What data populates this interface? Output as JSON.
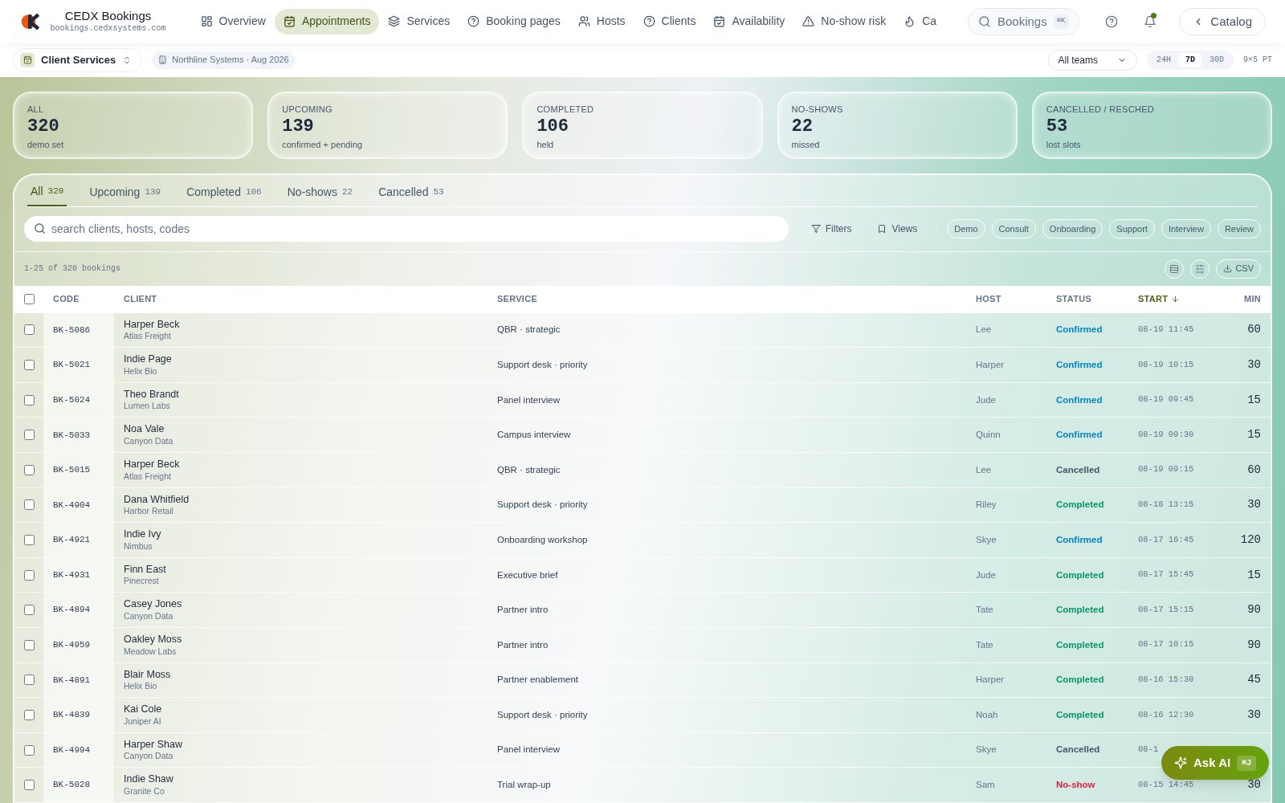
{
  "brand": {
    "name": "CEDX Bookings",
    "domain": "bookings.cedxsystems.com"
  },
  "nav": [
    {
      "label": "Overview",
      "selected": false
    },
    {
      "label": "Appointments",
      "selected": true
    },
    {
      "label": "Services",
      "selected": false
    },
    {
      "label": "Booking pages",
      "selected": false
    },
    {
      "label": "Hosts",
      "selected": false
    },
    {
      "label": "Clients",
      "selected": false
    },
    {
      "label": "Availability",
      "selected": false
    },
    {
      "label": "No-show risk",
      "selected": false
    },
    {
      "label": "Ca",
      "selected": false
    }
  ],
  "search_button": {
    "label": "Bookings",
    "shortcut": "⌘K"
  },
  "notifications": {
    "unread": true
  },
  "back_button": "Catalog",
  "workspace": {
    "label": "Client Services"
  },
  "org_chip": "Northline Systems · Aug 2026",
  "team_select": "All teams",
  "ranges": [
    {
      "label": "24H",
      "selected": false
    },
    {
      "label": "7D",
      "selected": true
    },
    {
      "label": "30D",
      "selected": false
    }
  ],
  "grid_label": "9×5 PT",
  "kpis": [
    {
      "label": "ALL",
      "value": "320",
      "sub": "demo set"
    },
    {
      "label": "UPCOMING",
      "value": "139",
      "sub": "confirmed + pending"
    },
    {
      "label": "COMPLETED",
      "value": "106",
      "sub": "held"
    },
    {
      "label": "NO-SHOWS",
      "value": "22",
      "sub": "missed"
    },
    {
      "label": "CANCELLED / RESCHED",
      "value": "53",
      "sub": "lost slots"
    }
  ],
  "tabs": [
    {
      "label": "All",
      "count": "320",
      "selected": true
    },
    {
      "label": "Upcoming",
      "count": "139",
      "selected": false
    },
    {
      "label": "Completed",
      "count": "106",
      "selected": false
    },
    {
      "label": "No-shows",
      "count": "22",
      "selected": false
    },
    {
      "label": "Cancelled",
      "count": "53",
      "selected": false
    }
  ],
  "search": {
    "placeholder": "search clients, hosts, codes"
  },
  "filters_button": "Filters",
  "views_button": "Views",
  "tags": [
    "Demo",
    "Consult",
    "Onboarding",
    "Support",
    "Interview",
    "Review"
  ],
  "result_count": "1-25 of 320 bookings",
  "csv_button": "CSV",
  "table": {
    "all_selected": false,
    "columns": [
      {
        "label": "CODE",
        "sorted": false
      },
      {
        "label": "CLIENT",
        "sorted": false
      },
      {
        "label": "SERVICE",
        "sorted": false
      },
      {
        "label": "HOST",
        "sorted": false
      },
      {
        "label": "STATUS",
        "sorted": false
      },
      {
        "label": "START",
        "sorted": true
      },
      {
        "label": "MIN",
        "sorted": false
      }
    ],
    "rows": [
      {
        "checked": false,
        "code": "BK-5086",
        "client": "Harper Beck",
        "company": "Atlas Freight",
        "service": "QBR · strategic",
        "host": "Lee",
        "status": "Confirmed",
        "kind": "confirmed",
        "start": "08-19 11:45",
        "min": "60"
      },
      {
        "checked": false,
        "code": "BK-5021",
        "client": "Indie Page",
        "company": "Helix Bio",
        "service": "Support desk · priority",
        "host": "Harper",
        "status": "Confirmed",
        "kind": "confirmed",
        "start": "08-19 10:15",
        "min": "30"
      },
      {
        "checked": false,
        "code": "BK-5024",
        "client": "Theo Brandt",
        "company": "Lumen Labs",
        "service": "Panel interview",
        "host": "Jude",
        "status": "Confirmed",
        "kind": "confirmed",
        "start": "08-19 09:45",
        "min": "15"
      },
      {
        "checked": false,
        "code": "BK-5033",
        "client": "Noa Vale",
        "company": "Canyon Data",
        "service": "Campus interview",
        "host": "Quinn",
        "status": "Confirmed",
        "kind": "confirmed",
        "start": "08-19 09:30",
        "min": "15"
      },
      {
        "checked": false,
        "code": "BK-5015",
        "client": "Harper Beck",
        "company": "Atlas Freight",
        "service": "QBR · strategic",
        "host": "Lee",
        "status": "Cancelled",
        "kind": "cancelled",
        "start": "08-19 09:15",
        "min": "60"
      },
      {
        "checked": false,
        "code": "BK-4904",
        "client": "Dana Whitfield",
        "company": "Harbor Retail",
        "service": "Support desk · priority",
        "host": "Riley",
        "status": "Completed",
        "kind": "completed",
        "start": "08-18 13:15",
        "min": "30"
      },
      {
        "checked": false,
        "code": "BK-4921",
        "client": "Indie Ivy",
        "company": "Nimbus",
        "service": "Onboarding workshop",
        "host": "Skye",
        "status": "Confirmed",
        "kind": "confirmed",
        "start": "08-17 16:45",
        "min": "120"
      },
      {
        "checked": false,
        "code": "BK-4931",
        "client": "Finn East",
        "company": "Pinecrest",
        "service": "Executive brief",
        "host": "Jude",
        "status": "Completed",
        "kind": "completed",
        "start": "08-17 15:45",
        "min": "15"
      },
      {
        "checked": false,
        "code": "BK-4894",
        "client": "Casey Jones",
        "company": "Canyon Data",
        "service": "Partner intro",
        "host": "Tate",
        "status": "Completed",
        "kind": "completed",
        "start": "08-17 15:15",
        "min": "90"
      },
      {
        "checked": false,
        "code": "BK-4959",
        "client": "Oakley Moss",
        "company": "Meadow Labs",
        "service": "Partner intro",
        "host": "Tate",
        "status": "Completed",
        "kind": "completed",
        "start": "08-17 10:15",
        "min": "90"
      },
      {
        "checked": false,
        "code": "BK-4891",
        "client": "Blair Moss",
        "company": "Helix Bio",
        "service": "Partner enablement",
        "host": "Harper",
        "status": "Completed",
        "kind": "completed",
        "start": "08-16 15:30",
        "min": "45"
      },
      {
        "checked": false,
        "code": "BK-4839",
        "client": "Kai Cole",
        "company": "Juniper AI",
        "service": "Support desk · priority",
        "host": "Noah",
        "status": "Completed",
        "kind": "completed",
        "start": "08-16 12:30",
        "min": "30"
      },
      {
        "checked": false,
        "code": "BK-4994",
        "client": "Harper Shaw",
        "company": "Canyon Data",
        "service": "Panel interview",
        "host": "Skye",
        "status": "Cancelled",
        "kind": "cancelled",
        "start": "08-1"
      },
      {
        "checked": false,
        "code": "BK-5028",
        "client": "Indie Shaw",
        "company": "Granite Co",
        "service": "Trial wrap-up",
        "host": "Sam",
        "status": "No-show",
        "kind": "noshow",
        "start": "08-15 14:45",
        "min": "30"
      }
    ]
  },
  "ask_ai": {
    "label": "Ask AI",
    "shortcut": "⌘J"
  }
}
